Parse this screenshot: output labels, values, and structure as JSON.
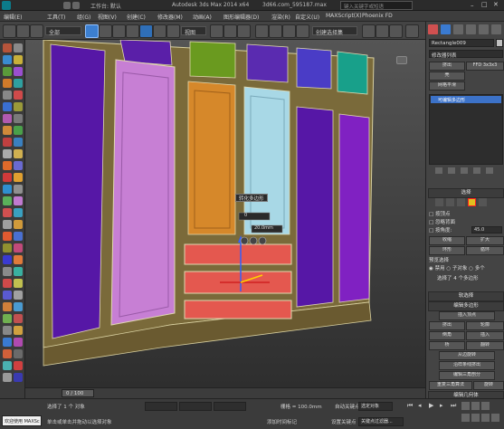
{
  "titlebar": {
    "workspace_label": "工作台: 默认",
    "app_title": "Autodesk 3ds Max 2014 x64",
    "file_name": "3d66.com_595187.max",
    "search_placeholder": "键入关键字或短语"
  },
  "menu": [
    "编辑(E)",
    "工具(T)",
    "组(G)",
    "视图(V)",
    "创建(C)",
    "修改器(M)",
    "动画(A)",
    "图形编辑器(D)",
    "渲染(R)",
    "自定义(U)",
    "MAXScript(X)",
    "Phoenix FD"
  ],
  "toolbar": {
    "selection_filter": "全部",
    "view_dropdown": "视图",
    "named_selection": "创建选择集"
  },
  "viewport": {
    "caption_label": "转化多边形",
    "spinner1": "0",
    "spinner2": "20.0mm",
    "panel_colors": [
      "#c77fd4",
      "#5a1fa8",
      "#6a9a1f",
      "#5a2bb0",
      "#4a3cc6",
      "#18a08a",
      "#d6882a",
      "#a8d8e6",
      "#5617a6",
      "#8021c2",
      "#e4584f"
    ]
  },
  "right_panel": {
    "object_name": "Rectangle009",
    "modifier_list": "修改器列表",
    "btn_extrude": "挤出",
    "btn_ffd": "FFD 3x3x3",
    "btn_shell": "壳",
    "btn_mesh_smooth": "网格平滑",
    "stack_item": "可编辑多边形",
    "section_select": "选择",
    "cb_vertex": "按顶点",
    "cb_ignore_back": "忽略背面",
    "cb_angle": "按角度:",
    "angle_value": "45.0",
    "btn_shrink": "收缩",
    "btn_grow": "扩大",
    "btn_ring": "环形",
    "btn_loop": "循环",
    "preview_label": "预览选择",
    "radio_disable": "禁用",
    "radio_subobj": "子对象",
    "radio_multi": "多个",
    "selected_text": "选择了 4 个多边形",
    "section_soft": "软选择",
    "section_edit_poly": "编辑多边形",
    "insert_vertex": "插入顶点",
    "btn_extrude2": "挤出",
    "btn_outline": "轮廓",
    "btn_bevel": "倒角",
    "btn_inset": "插入",
    "btn_bridge": "桥",
    "btn_flip": "翻转",
    "btn_from_edge": "从边旋转",
    "btn_hinge": "沿样条线挤出",
    "btn_edit_tri": "编辑三角剖分",
    "btn_retri": "重复三角算法",
    "btn_turn": "旋转",
    "section_geom": "编辑几何体",
    "btn_repeat": "重复上一个"
  },
  "timeline": {
    "frame_counter": "0 / 100"
  },
  "status": {
    "selected": "选择了 1 个 对象",
    "hint": "单击或单击并拖动以选择对象",
    "grid": "栅格 = 100.0mm",
    "auto_key": "自动关键点",
    "set_key": "设置关键点",
    "selected_obj": "选定对象",
    "key_filter": "关键点过滤器...",
    "add_time_tag": "添加时间标记",
    "welcome": "欢迎使用 MAXSc"
  }
}
